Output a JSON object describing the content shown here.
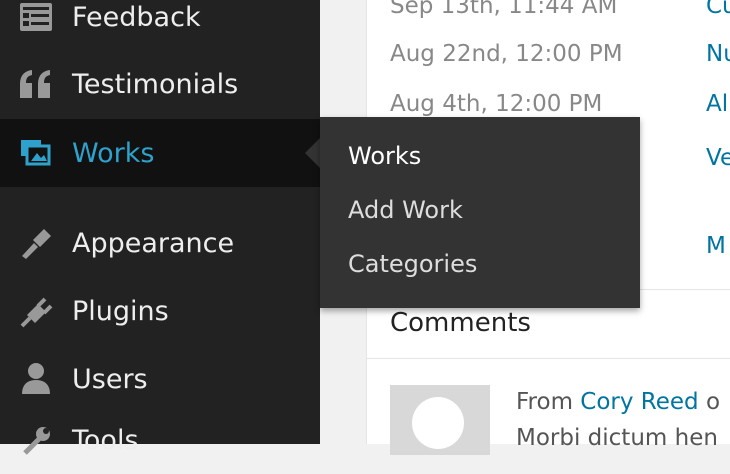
{
  "sidebar": {
    "items": [
      {
        "label": "Feedback",
        "icon": "feedback-icon"
      },
      {
        "label": "Testimonials",
        "icon": "quote-icon"
      },
      {
        "label": "Works",
        "icon": "works-icon",
        "active": true
      },
      {
        "label": "Appearance",
        "icon": "paintbrush-icon"
      },
      {
        "label": "Plugins",
        "icon": "plug-icon"
      },
      {
        "label": "Users",
        "icon": "user-icon"
      },
      {
        "label": "Tools",
        "icon": "wrench-icon"
      }
    ]
  },
  "flyout": {
    "items": [
      {
        "label": "Works"
      },
      {
        "label": "Add Work"
      },
      {
        "label": "Categories"
      }
    ]
  },
  "activity": {
    "rows": [
      {
        "date": "Sep 13th, 11:44 AM",
        "link": "Cu"
      },
      {
        "date": "Aug 22nd, 12:00 PM",
        "link": "Nu"
      },
      {
        "date": "Aug 4th, 12:00 PM",
        "link": "Al"
      },
      {
        "date": "",
        "link": "Ve"
      },
      {
        "date": "",
        "link": "M"
      }
    ]
  },
  "comments": {
    "title": "Comments",
    "from_prefix": "From ",
    "author": "Cory Reed",
    "from_suffix": " o",
    "excerpt": "Morbi dictum hen"
  },
  "colors": {
    "sidebar_bg": "#222222",
    "active_bg": "#111111",
    "accent": "#2ea2cc",
    "link": "#0074a2",
    "flyout_bg": "#333333"
  }
}
